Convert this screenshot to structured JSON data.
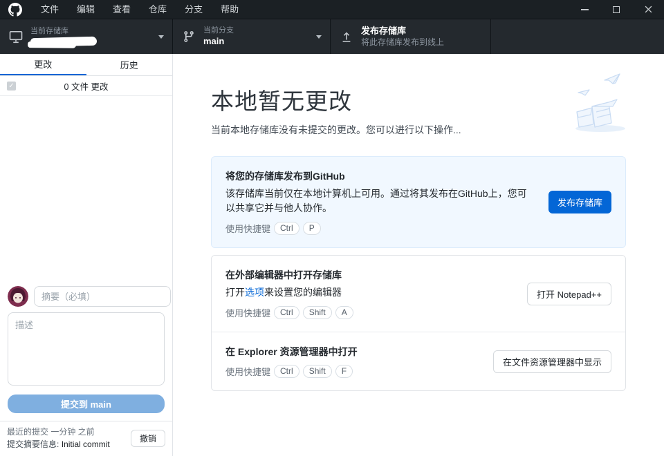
{
  "titlebar": {
    "menu_items": [
      "文件",
      "编辑",
      "查看",
      "仓库",
      "分支",
      "帮助"
    ]
  },
  "toolbar": {
    "repository": {
      "label": "当前存储库"
    },
    "branch": {
      "label": "当前分支",
      "name": "main"
    },
    "publish": {
      "title": "发布存储库",
      "subtitle": "将此存储库发布到线上"
    }
  },
  "sidebar": {
    "tabs": {
      "changes": "更改",
      "history": "历史"
    },
    "files_changed": "0 文件 更改",
    "commit": {
      "summary_placeholder": "摘要（必填）",
      "description_placeholder": "描述",
      "commit_button_label": "提交到 main"
    },
    "recent": {
      "title": "最近的提交 一分钟 之前",
      "summary_label": "提交摘要信息:",
      "summary_value": "Initial commit",
      "undo_label": "撤销"
    }
  },
  "main": {
    "title": "本地暂无更改",
    "subtitle": "当前本地存储库没有未提交的更改。您可以进行以下操作...",
    "publish_card": {
      "title": "将您的存储库发布到GitHub",
      "description": "该存储库当前仅在本地计算机上可用。通过将其发布在GitHub上，您可以共享它并与他人协作。",
      "shortcut_label": "使用快捷键",
      "keys": [
        "Ctrl",
        "P"
      ],
      "button_label": "发布存储库"
    },
    "editor_card": {
      "title": "在外部编辑器中打开存储库",
      "desc_prefix": "打开",
      "desc_link": "选项",
      "desc_suffix": "来设置您的编辑器",
      "shortcut_label": "使用快捷键",
      "keys": [
        "Ctrl",
        "Shift",
        "A"
      ],
      "button_label": "打开 Notepad++"
    },
    "explorer_card": {
      "title": "在 Explorer 资源管理器中打开",
      "shortcut_label": "使用快捷键",
      "keys": [
        "Ctrl",
        "Shift",
        "F"
      ],
      "button_label": "在文件资源管理器中显示"
    }
  },
  "colors": {
    "accent_blue": "#0366d6",
    "titlebar_bg": "#1b2024",
    "toolbar_bg": "#24292e",
    "publish_card_bg": "#f1f8ff",
    "disabled_commit_bg": "#7fafe0"
  }
}
